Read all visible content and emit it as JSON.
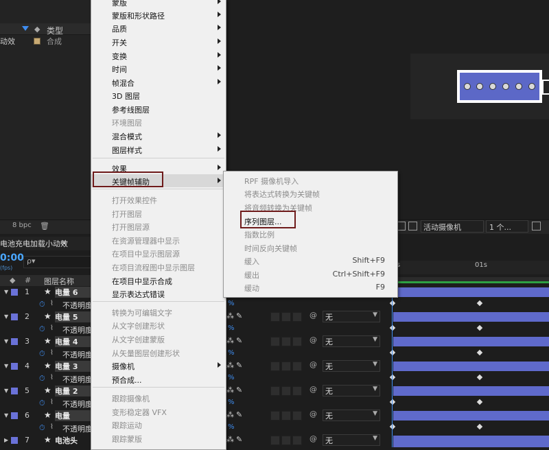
{
  "project_panel": {
    "col_type": "类型",
    "item_name": "动效",
    "item_type": "合成"
  },
  "viewer_bar": {
    "bpc": "8 bpc",
    "trash_icon": "trash-icon",
    "camera_select": "活动摄像机",
    "views_select": "1 个..."
  },
  "timeline": {
    "tab_title": "电池充电加载小动效",
    "tab_menu": "≡",
    "timecode": "0:00",
    "fps": "(fps)",
    "search_placeholder": "ρ▾",
    "col_num": "#",
    "col_layer_name": "图层名称",
    "ruler_start": "s",
    "ruler_1s": "01s",
    "layers": [
      {
        "num": "1",
        "name": "电量 6",
        "prop": "不透明度"
      },
      {
        "num": "2",
        "name": "电量 5",
        "prop": "不透明度"
      },
      {
        "num": "3",
        "name": "电量 4",
        "prop": "不透明度"
      },
      {
        "num": "4",
        "name": "电量 3",
        "prop": "不透明度"
      },
      {
        "num": "5",
        "name": "电量 2",
        "prop": "不透明度"
      },
      {
        "num": "6",
        "name": "电量",
        "prop": "不透明度"
      },
      {
        "num": "7",
        "name": "电池头",
        "prop": ""
      }
    ],
    "pct_suffix": "%",
    "parent_value": "无"
  },
  "menu1": {
    "items": [
      {
        "label": "蒙版",
        "submenu": true,
        "disabled": false
      },
      {
        "label": "蒙版和形状路径",
        "submenu": true,
        "disabled": false
      },
      {
        "label": "品质",
        "submenu": true,
        "disabled": false
      },
      {
        "label": "开关",
        "submenu": true,
        "disabled": false
      },
      {
        "label": "变换",
        "submenu": true,
        "disabled": false
      },
      {
        "label": "时间",
        "submenu": true,
        "disabled": false
      },
      {
        "label": "帧混合",
        "submenu": true,
        "disabled": false
      },
      {
        "label": "3D 图层",
        "submenu": false,
        "disabled": false
      },
      {
        "label": "参考线图层",
        "submenu": false,
        "disabled": false
      },
      {
        "label": "环境图层",
        "submenu": false,
        "disabled": true
      },
      {
        "label": "混合模式",
        "submenu": true,
        "disabled": false
      },
      {
        "label": "图层样式",
        "submenu": true,
        "disabled": false
      },
      {
        "label": "效果",
        "submenu": true,
        "disabled": false
      },
      {
        "label": "关键帧辅助",
        "submenu": true,
        "disabled": false
      },
      {
        "label": "打开效果控件",
        "submenu": false,
        "disabled": true
      },
      {
        "label": "打开图层",
        "submenu": false,
        "disabled": true
      },
      {
        "label": "打开图层源",
        "submenu": false,
        "disabled": true
      },
      {
        "label": "在资源管理器中显示",
        "submenu": false,
        "disabled": true
      },
      {
        "label": "在项目中显示图层源",
        "submenu": false,
        "disabled": true
      },
      {
        "label": "在项目流程图中显示图层",
        "submenu": false,
        "disabled": true
      },
      {
        "label": "在项目中显示合成",
        "submenu": false,
        "disabled": false
      },
      {
        "label": "显示表达式错误",
        "submenu": false,
        "disabled": false
      },
      {
        "label": "转换为可编辑文字",
        "submenu": false,
        "disabled": true
      },
      {
        "label": "从文字创建形状",
        "submenu": false,
        "disabled": true
      },
      {
        "label": "从文字创建蒙版",
        "submenu": false,
        "disabled": true
      },
      {
        "label": "从矢量图层创建形状",
        "submenu": false,
        "disabled": true
      },
      {
        "label": "摄像机",
        "submenu": true,
        "disabled": false
      },
      {
        "label": "预合成...",
        "submenu": false,
        "disabled": false
      },
      {
        "label": "跟踪摄像机",
        "submenu": false,
        "disabled": true
      },
      {
        "label": "变形稳定器 VFX",
        "submenu": false,
        "disabled": true
      },
      {
        "label": "跟踪运动",
        "submenu": false,
        "disabled": true
      },
      {
        "label": "跟踪蒙版",
        "submenu": false,
        "disabled": true
      }
    ]
  },
  "menu2": {
    "items": [
      {
        "label": "RPF 摄像机导入",
        "shortcut": "",
        "disabled": true
      },
      {
        "label": "将表达式转换为关键帧",
        "shortcut": "",
        "disabled": true
      },
      {
        "label": "将音频转换为关键帧",
        "shortcut": "",
        "disabled": true
      },
      {
        "label": "序列图层...",
        "shortcut": "",
        "disabled": false
      },
      {
        "label": "指数比例",
        "shortcut": "",
        "disabled": true
      },
      {
        "label": "时间反向关键帧",
        "shortcut": "",
        "disabled": true
      },
      {
        "label": "缓入",
        "shortcut": "Shift+F9",
        "disabled": true
      },
      {
        "label": "缓出",
        "shortcut": "Ctrl+Shift+F9",
        "disabled": true
      },
      {
        "label": "缓动",
        "shortcut": "F9",
        "disabled": true
      }
    ]
  }
}
